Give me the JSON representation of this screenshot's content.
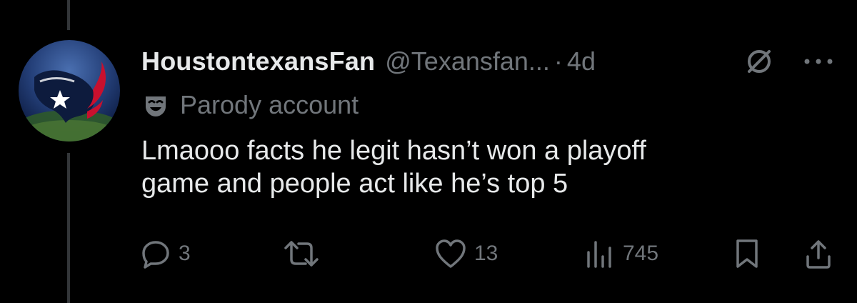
{
  "post": {
    "display_name": "HoustontexansFan",
    "handle": "@Texansfan...",
    "separator": "·",
    "time": "4d",
    "label": "Parody account",
    "text_line1": "Lmaooo facts he legit hasn’t won a playoff",
    "text_line2": "game and people act like he’s top 5"
  },
  "actions": {
    "replies": "3",
    "reposts": "",
    "likes": "13",
    "views": "745"
  },
  "icons": {
    "grok": "grok-icon",
    "more": "more-icon",
    "parody": "mask-icon",
    "reply": "reply-icon",
    "repost": "repost-icon",
    "like": "heart-icon",
    "views": "views-icon",
    "bookmark": "bookmark-icon",
    "share": "share-icon"
  },
  "colors": {
    "background": "#000000",
    "primary_text": "#e7e9ea",
    "secondary_text": "#71767b",
    "thread_line": "#333639"
  }
}
